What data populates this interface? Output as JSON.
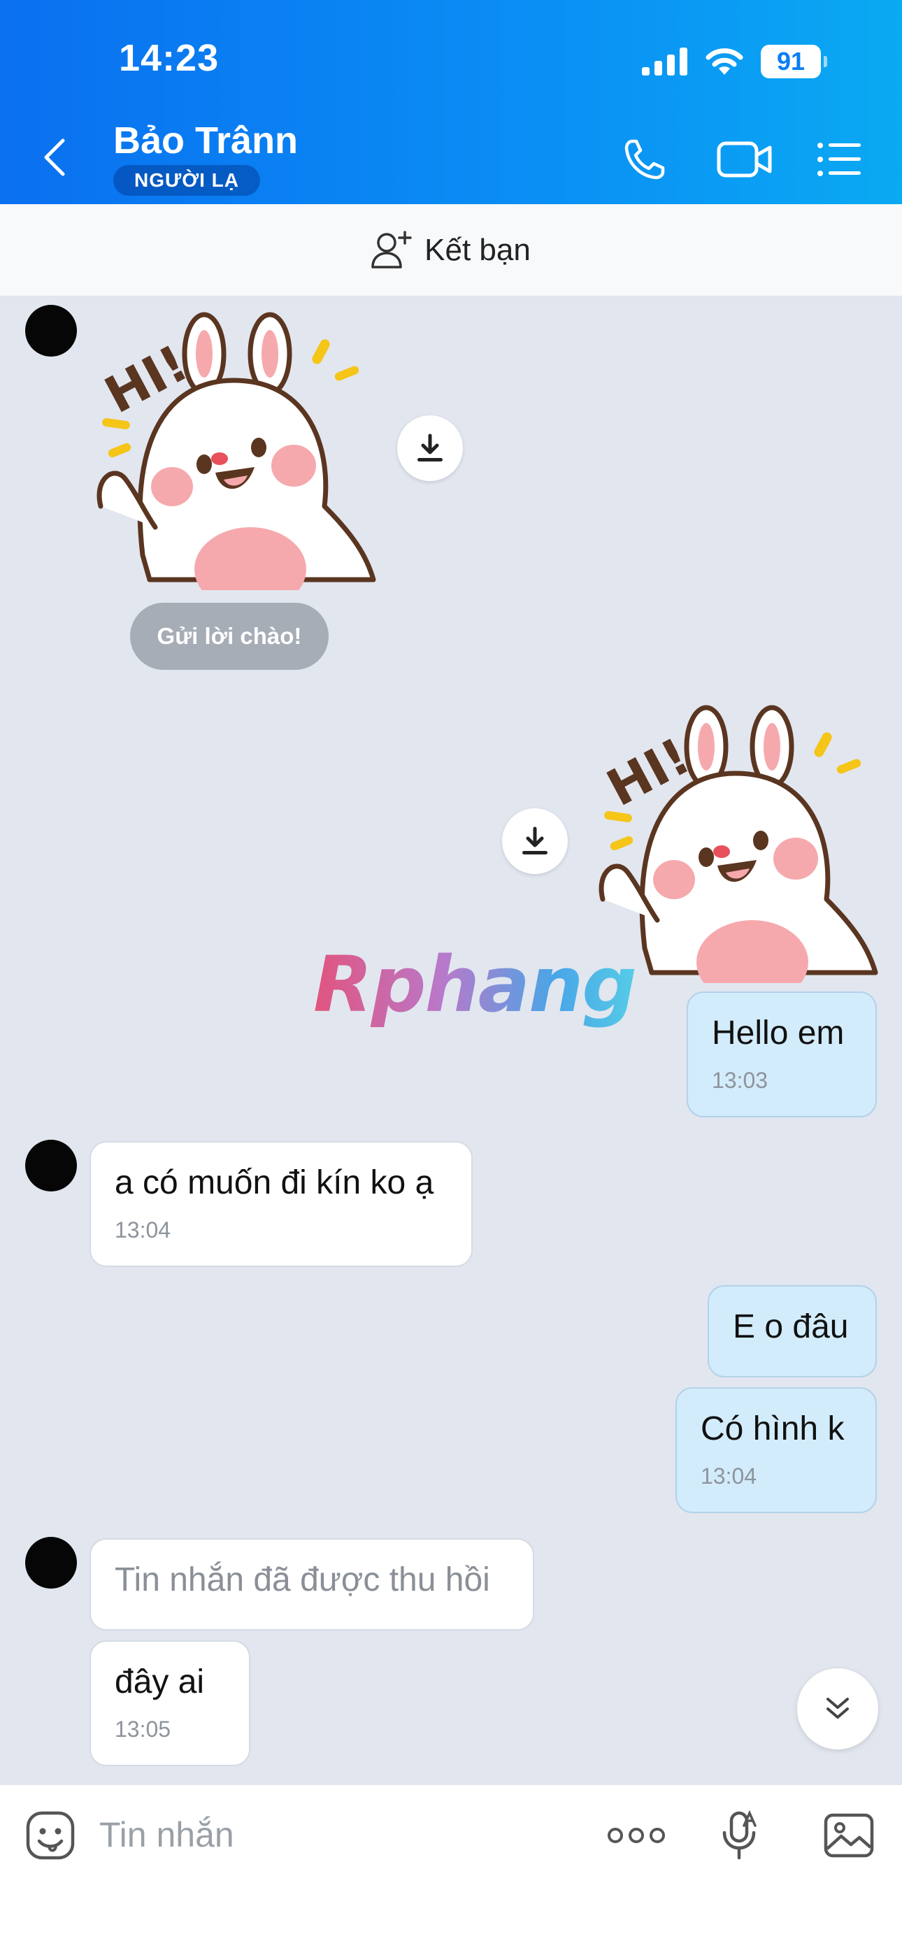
{
  "status_bar": {
    "time": "14:23",
    "battery": "91"
  },
  "header": {
    "contact_name": "Bảo Trânn",
    "badge": "NGƯỜI LẠ"
  },
  "friend_bar": {
    "label": "Kết bạn"
  },
  "chat": {
    "greeting_prompt": "Gửi lời chào!",
    "watermark": "Rphang",
    "messages": [
      {
        "text": "Hello em",
        "time": "13:03"
      },
      {
        "text": "a có muốn đi kín ko ạ",
        "time": "13:04"
      },
      {
        "text": "E o đâu"
      },
      {
        "text": "Có hình k",
        "time": "13:04"
      },
      {
        "text": "Tin nhắn đã được thu hồi"
      },
      {
        "text": "đây ai",
        "time": "13:05"
      }
    ]
  },
  "sticker": {
    "text": "HI!"
  },
  "input": {
    "placeholder": "Tin nhắn"
  },
  "colors": {
    "header_gradient_start": "#0a70f0",
    "header_gradient_end": "#0aa9f3",
    "outgoing_bubble": "#d3ecfb",
    "chat_background": "#e2e6ef"
  }
}
